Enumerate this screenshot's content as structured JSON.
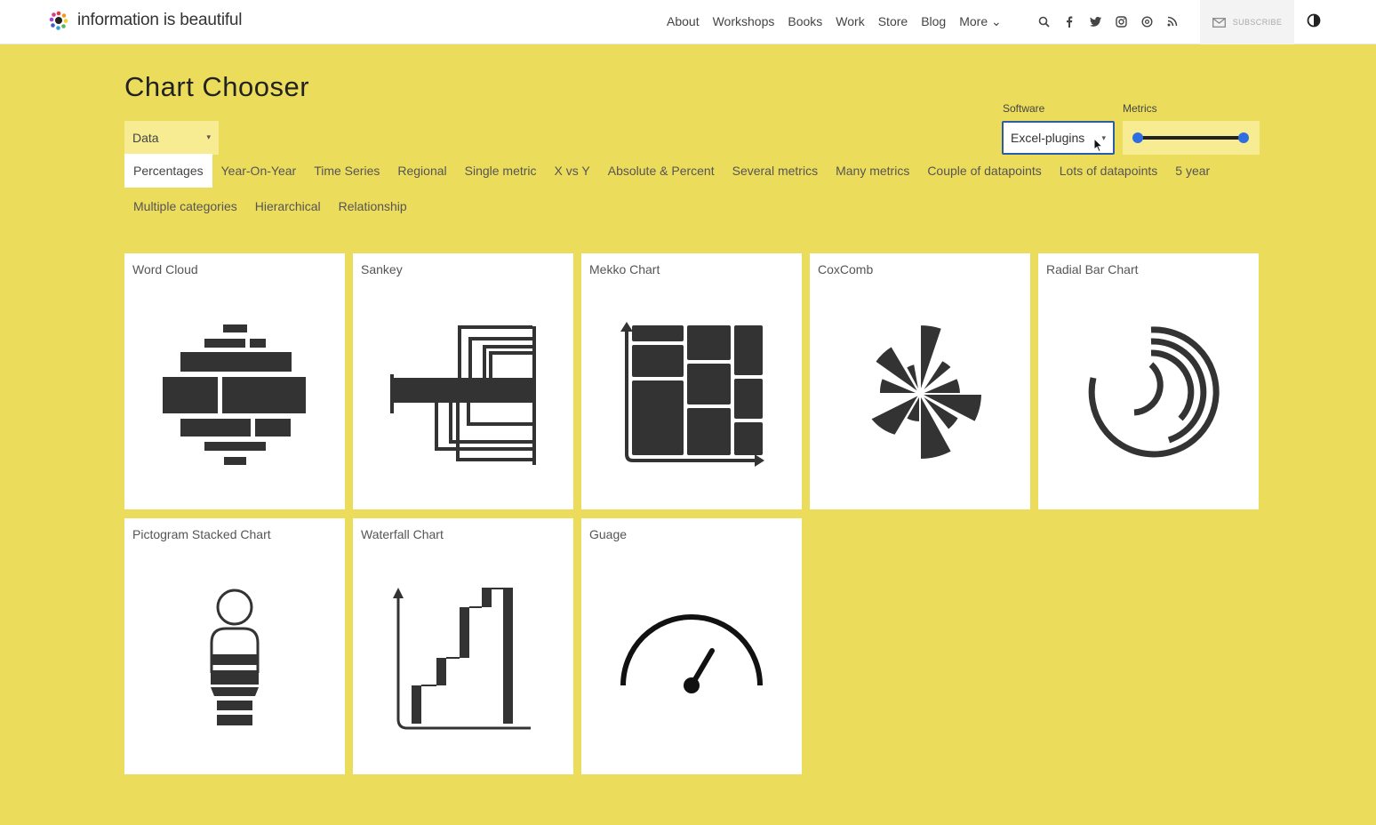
{
  "header": {
    "logo_text": "information is beautiful",
    "logo_icon": "flower-logo-icon",
    "nav": [
      "About",
      "Workshops",
      "Books",
      "Work",
      "Store",
      "Blog",
      "More ⌄"
    ],
    "icons": [
      "search-icon",
      "facebook-icon",
      "twitter-icon",
      "instagram-icon",
      "threads-icon",
      "rss-icon"
    ],
    "subscribe_label": "SUBSCRIBE"
  },
  "page": {
    "title": "Chart Chooser",
    "data_select": "Data",
    "software_label": "Software",
    "software_value": "Excel-plugins",
    "metrics_label": "Metrics",
    "metrics_range": [
      0,
      1
    ]
  },
  "tabs_row1": [
    "Percentages",
    "Year-On-Year",
    "Time Series",
    "Regional",
    "Single metric",
    "X vs Y",
    "Absolute & Percent",
    "Several metrics",
    "Many metrics",
    "Couple of datapoints",
    "Lots of datapoints",
    "5 year"
  ],
  "tabs_row2": [
    "Multiple categories",
    "Hierarchical",
    "Relationship"
  ],
  "active_tab": "Percentages",
  "cards": [
    {
      "title": "Word Cloud",
      "icon": "word-cloud-icon"
    },
    {
      "title": "Sankey",
      "icon": "sankey-icon"
    },
    {
      "title": "Mekko Chart",
      "icon": "mekko-chart-icon"
    },
    {
      "title": "CoxComb",
      "icon": "coxcomb-icon"
    },
    {
      "title": "Radial Bar Chart",
      "icon": "radial-bar-chart-icon"
    },
    {
      "title": "Pictogram Stacked Chart",
      "icon": "pictogram-stacked-icon"
    },
    {
      "title": "Waterfall Chart",
      "icon": "waterfall-chart-icon"
    },
    {
      "title": "Guage",
      "icon": "gauge-icon"
    }
  ],
  "colors": {
    "background": "#ecdc5c",
    "accent": "#2f6ee0",
    "icon": "#333333"
  }
}
